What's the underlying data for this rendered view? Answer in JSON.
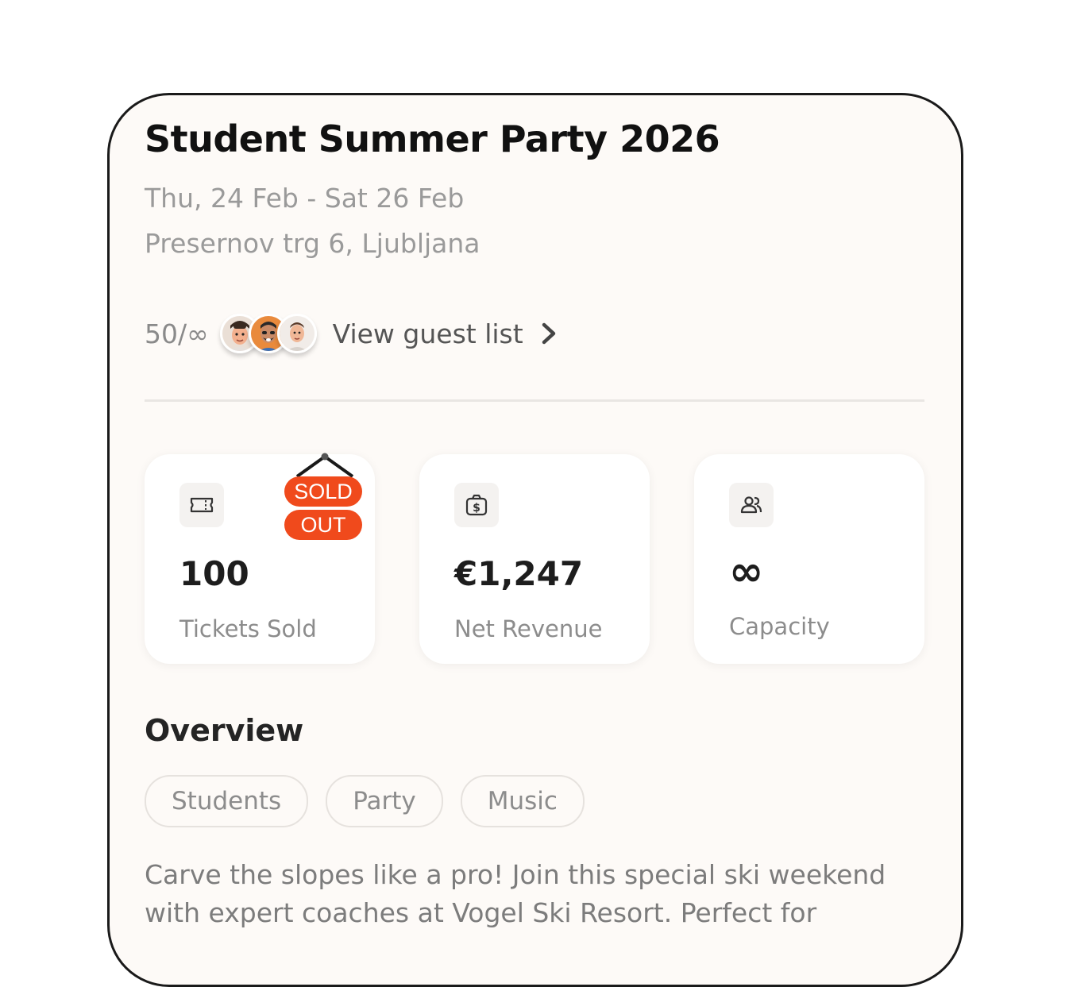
{
  "event": {
    "title": "Student Summer Party 2026",
    "dates": "Thu, 24 Feb - Sat 26 Feb",
    "location": "Presernov trg 6, Ljubljana"
  },
  "guests": {
    "count": "50/∞",
    "link_label": "View guest list",
    "avatars": [
      "avatar-guest-1",
      "avatar-guest-2",
      "avatar-guest-3"
    ]
  },
  "stats": [
    {
      "icon": "ticket-icon",
      "value": "100",
      "label": "Tickets Sold"
    },
    {
      "icon": "money-bag-icon",
      "value": "€1,247",
      "label": "Net Revenue"
    },
    {
      "icon": "people-icon",
      "value": "∞",
      "label": "Capacity"
    }
  ],
  "sold_out_sign": {
    "line1": "SOLD",
    "line2": "OUT",
    "color": "#f04a1c"
  },
  "overview": {
    "title": "Overview",
    "tags": [
      "Students",
      "Party",
      "Music"
    ],
    "description": "Carve the slopes like a pro! Join this special ski weekend with expert coaches at Vogel Ski Resort. Perfect for"
  },
  "colors": {
    "background": "#fdfaf7",
    "accent": "#f04a1c",
    "text_primary": "#111111",
    "text_secondary": "#9a9a9a"
  }
}
